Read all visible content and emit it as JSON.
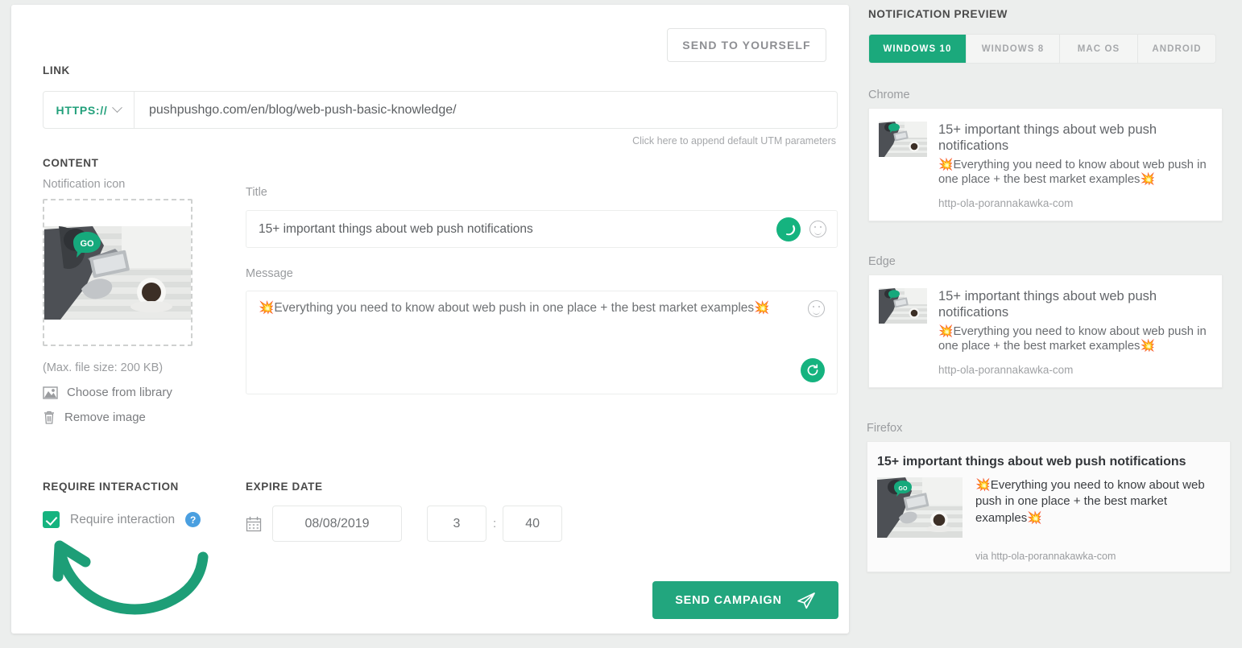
{
  "form": {
    "send_to_yourself_label": "SEND TO YOURSELF",
    "link_section_label": "LINK",
    "protocol_value": "HTTPS://",
    "url_value": "pushpushgo.com/en/blog/web-push-basic-knowledge/",
    "utm_hint": "Click here to append default UTM parameters",
    "content_section_label": "CONTENT",
    "notification_icon_label": "Notification icon",
    "max_file_size": "(Max. file size: 200 KB)",
    "choose_from_library": "Choose from library",
    "remove_image": "Remove image",
    "title_label": "Title",
    "title_value": "15+ important things about web push notifications",
    "message_label": "Message",
    "message_emoji_lead": "💥",
    "message_text": "Everything you need to know about web push in one place + the best market examples",
    "message_emoji_trail": "💥",
    "require_interaction_section": "REQUIRE INTERACTION",
    "require_interaction_label": "Require interaction",
    "require_interaction_checked": true,
    "help_glyph": "?",
    "expire_date_section": "EXPIRE DATE",
    "expire_date_value": "08/08/2019",
    "expire_hour_value": "3",
    "expire_minute_value": "40",
    "time_separator": ":",
    "send_campaign_label": "SEND CAMPAIGN"
  },
  "preview": {
    "heading": "NOTIFICATION PREVIEW",
    "tabs": [
      {
        "label": "WINDOWS 10",
        "active": true
      },
      {
        "label": "WINDOWS 8",
        "active": false
      },
      {
        "label": "MAC OS",
        "active": false
      },
      {
        "label": "ANDROID",
        "active": false
      }
    ],
    "cards": [
      {
        "browser": "Chrome",
        "title": "15+ important things about web push notifications",
        "message": "Everything you need to know about web push in one place + the best market examples",
        "url": "http-ola-porannakawka-com"
      },
      {
        "browser": "Edge",
        "title": "15+ important things about web push notifications",
        "message": "Everything you need to know about web push in one place + the best market examples",
        "url": "http-ola-porannakawka-com"
      }
    ],
    "firefox": {
      "browser": "Firefox",
      "title": "15+ important things about web push notifications",
      "message": "Everything you need to know about web push in one place + the best market examples",
      "url": "via http-ola-porannakawka-com"
    },
    "emoji": "💥"
  },
  "colors": {
    "accent_green": "#22a67e",
    "spinner_green": "#15b37f",
    "tab_active": "#1ba97c",
    "help_blue": "#4a9fe0",
    "page_bg": "#eceeed"
  }
}
